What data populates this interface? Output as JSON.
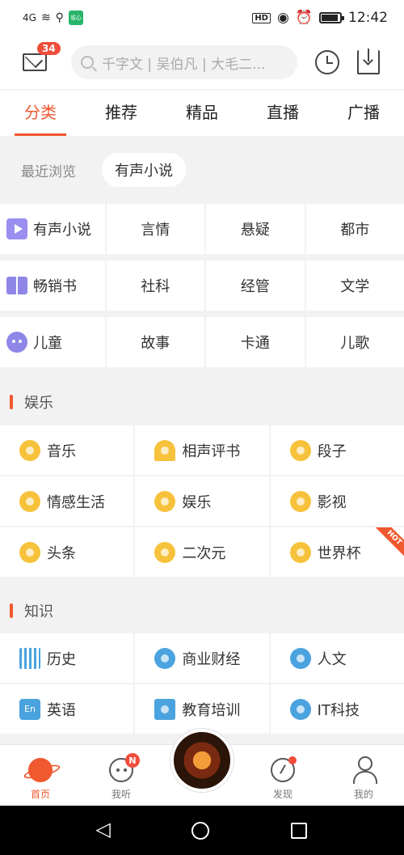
{
  "status": {
    "time": "12:42",
    "network": "4G",
    "hd": "HD",
    "app_badge": "省心"
  },
  "header": {
    "mail_count": "34",
    "search_placeholder": "千字文 | 吴伯凡 | 大毛二..."
  },
  "tabs": [
    {
      "label": "分类",
      "active": true
    },
    {
      "label": "推荐"
    },
    {
      "label": "精品"
    },
    {
      "label": "直播"
    },
    {
      "label": "广播"
    }
  ],
  "recent": {
    "label": "最近浏览",
    "chip": "有声小说"
  },
  "categories": [
    [
      "有声小说",
      "言情",
      "悬疑",
      "都市"
    ],
    [
      "畅销书",
      "社科",
      "经管",
      "文学"
    ],
    [
      "儿童",
      "故事",
      "卡通",
      "儿歌"
    ]
  ],
  "sections": [
    {
      "title": "娱乐",
      "items": [
        "音乐",
        "相声评书",
        "段子",
        "情感生活",
        "娱乐",
        "影视",
        "头条",
        "二次元",
        "世界杯"
      ],
      "hot_badge": "HOT"
    },
    {
      "title": "知识",
      "items": [
        "历史",
        "商业财经",
        "人文",
        "英语",
        "教育培训",
        "IT科技"
      ]
    }
  ],
  "bottom_nav": [
    {
      "label": "首页",
      "active": true
    },
    {
      "label": "我听",
      "badge": "N"
    },
    {
      "label": ""
    },
    {
      "label": "发现"
    },
    {
      "label": "我的"
    }
  ],
  "colors": {
    "accent": "#f0582f",
    "badge": "#f04d3a",
    "icon_yellow": "#f7c23b",
    "icon_blue": "#4aa3df",
    "icon_purple": "#8f86e8"
  }
}
